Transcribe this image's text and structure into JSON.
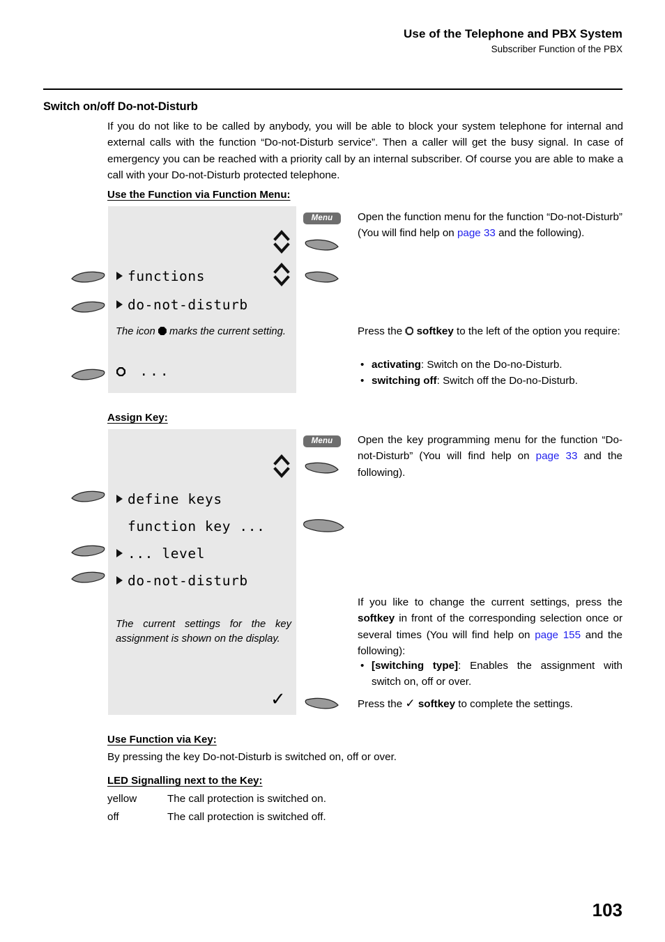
{
  "header": {
    "title": "Use of the Telephone and PBX System",
    "subtitle": "Subscriber Function of the PBX"
  },
  "section": {
    "title": "Switch on/off Do-not-Disturb",
    "intro": "If you do not like to be called by anybody, you will be able to block your system telephone for internal and external calls with the function “Do-not-Disturb service”. Then a caller will get the busy signal. In case of emergency you can be reached with a priority call by an internal subscriber. Of course you are able to make a call with your Do-not-Disturb protected telephone."
  },
  "block1": {
    "heading": "Use the Function via Function Menu:",
    "menu_key_label": "Menu",
    "display_rows": [
      {
        "marker": "triangle",
        "text": "functions"
      },
      {
        "marker": "triangle",
        "text": "do-not-disturb"
      }
    ],
    "display_note_pre": "The icon",
    "display_note_post": "marks the current setting.",
    "display_last_row": "...",
    "instructions": {
      "para1_a": "Open the function menu for the function “Do-not-Disturb” (You will find help on ",
      "para1_link": "page 33",
      "para1_b": " and the following).",
      "para2_a": "Press the ",
      "para2_bold": "softkey",
      "para2_b": " to the left of the option you require:",
      "bullets": [
        {
          "bold": "activating",
          "rest": ": Switch on the Do-no-Disturb."
        },
        {
          "bold": "switching off",
          "rest": ": Switch off the Do-no-Disturb."
        }
      ]
    }
  },
  "block2": {
    "heading": "Assign Key:",
    "menu_key_label": "Menu",
    "display_rows": [
      {
        "marker": "triangle",
        "text": "define keys"
      },
      {
        "marker": "none",
        "text": "function key ..."
      },
      {
        "marker": "triangle",
        "text": "... level"
      },
      {
        "marker": "triangle",
        "text": "do-not-disturb"
      }
    ],
    "display_note": "The current settings for the key assignment is shown on the display.",
    "display_check": "✓",
    "instructions": {
      "para1_a": "Open the key programming menu for the function “Do-not-Disturb” (You will find help on ",
      "para1_link": "page 33",
      "para1_b": " and the following).",
      "para2_a": "If you like to change the current settings, press the ",
      "para2_bold": "softkey",
      "para2_b": " in front of the corresponding selection once or several times (You will find help on ",
      "para2_link": "page 155",
      "para2_c": " and the following):",
      "bullets": [
        {
          "bold": "[switching type]",
          "rest": ": Enables the assignment with switch on, off or over."
        }
      ],
      "para3_a": "Press the ",
      "para3_check": "✓",
      "para3_bold": "softkey",
      "para3_b": " to complete the settings."
    }
  },
  "block3": {
    "heading": "Use Function via Key:",
    "text": "By pressing the key Do-not-Disturb is switched on, off or over."
  },
  "block4": {
    "heading": "LED Signalling next to the Key:",
    "rows": [
      {
        "state": "yellow",
        "meaning": "The call protection is switched on."
      },
      {
        "state": "off",
        "meaning": "The call protection is switched off."
      }
    ]
  },
  "footer": {
    "page_number": "103"
  },
  "colors": {
    "lcd_background": "#e8e8e8",
    "softkey_fill": "#9a9a9a",
    "menu_key_fill": "#6e6e6e",
    "link": "#2222ee"
  }
}
